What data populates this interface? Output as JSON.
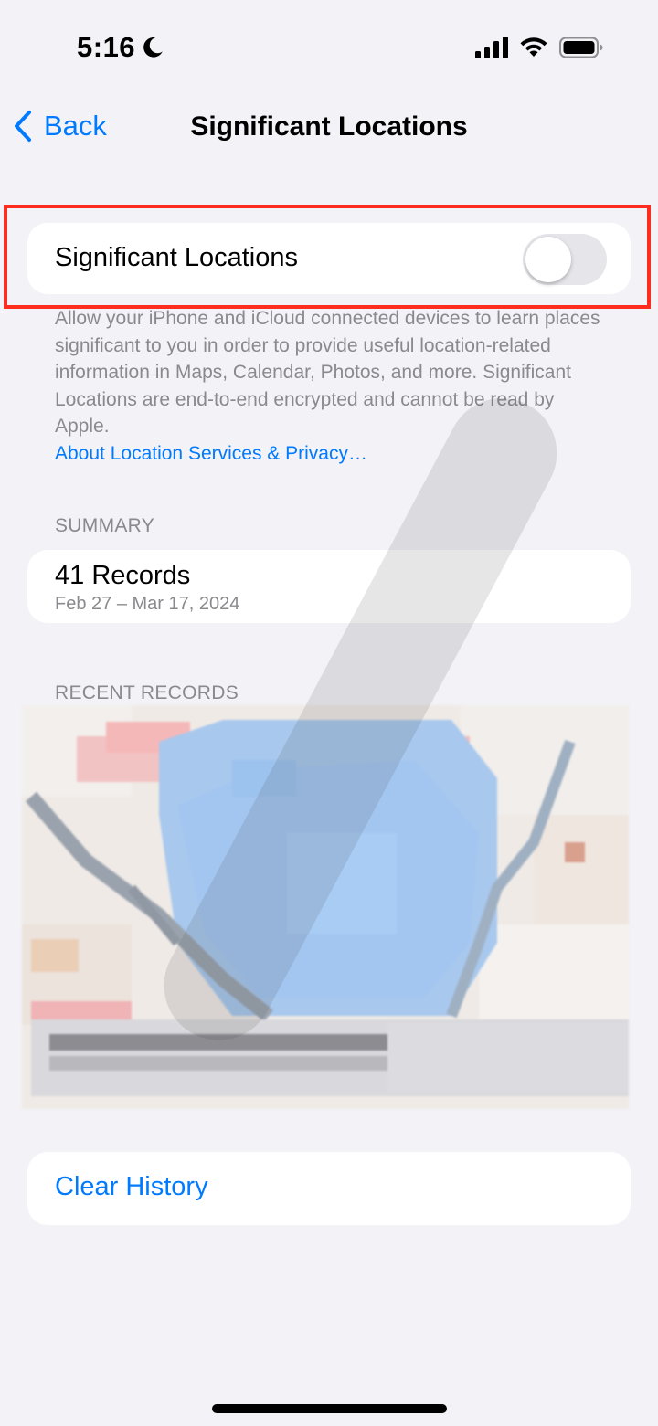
{
  "status_bar": {
    "time": "5:16",
    "moon_icon": "moon-icon",
    "signal_icon": "cellular-signal-icon",
    "wifi_icon": "wifi-icon",
    "battery_icon": "battery-icon"
  },
  "nav": {
    "back_label": "Back",
    "title": "Significant Locations"
  },
  "toggle_row": {
    "label": "Significant Locations",
    "enabled": false
  },
  "description": {
    "text": "Allow your iPhone and iCloud connected devices to learn places significant to you in order to provide useful location-related information in Maps, Calendar, Photos, and more. Significant Locations are end-to-end encrypted and cannot be read by Apple.",
    "link": "About Location Services & Privacy…"
  },
  "summary": {
    "header": "SUMMARY",
    "records": "41 Records",
    "date_range": "Feb 27 – Mar 17, 2024"
  },
  "recent": {
    "header": "RECENT RECORDS"
  },
  "clear_history": {
    "label": "Clear History"
  },
  "colors": {
    "background": "#f2f2f7",
    "accent": "#007aff",
    "secondary_text": "#8a8a8e",
    "highlight": "#ff2d20"
  }
}
